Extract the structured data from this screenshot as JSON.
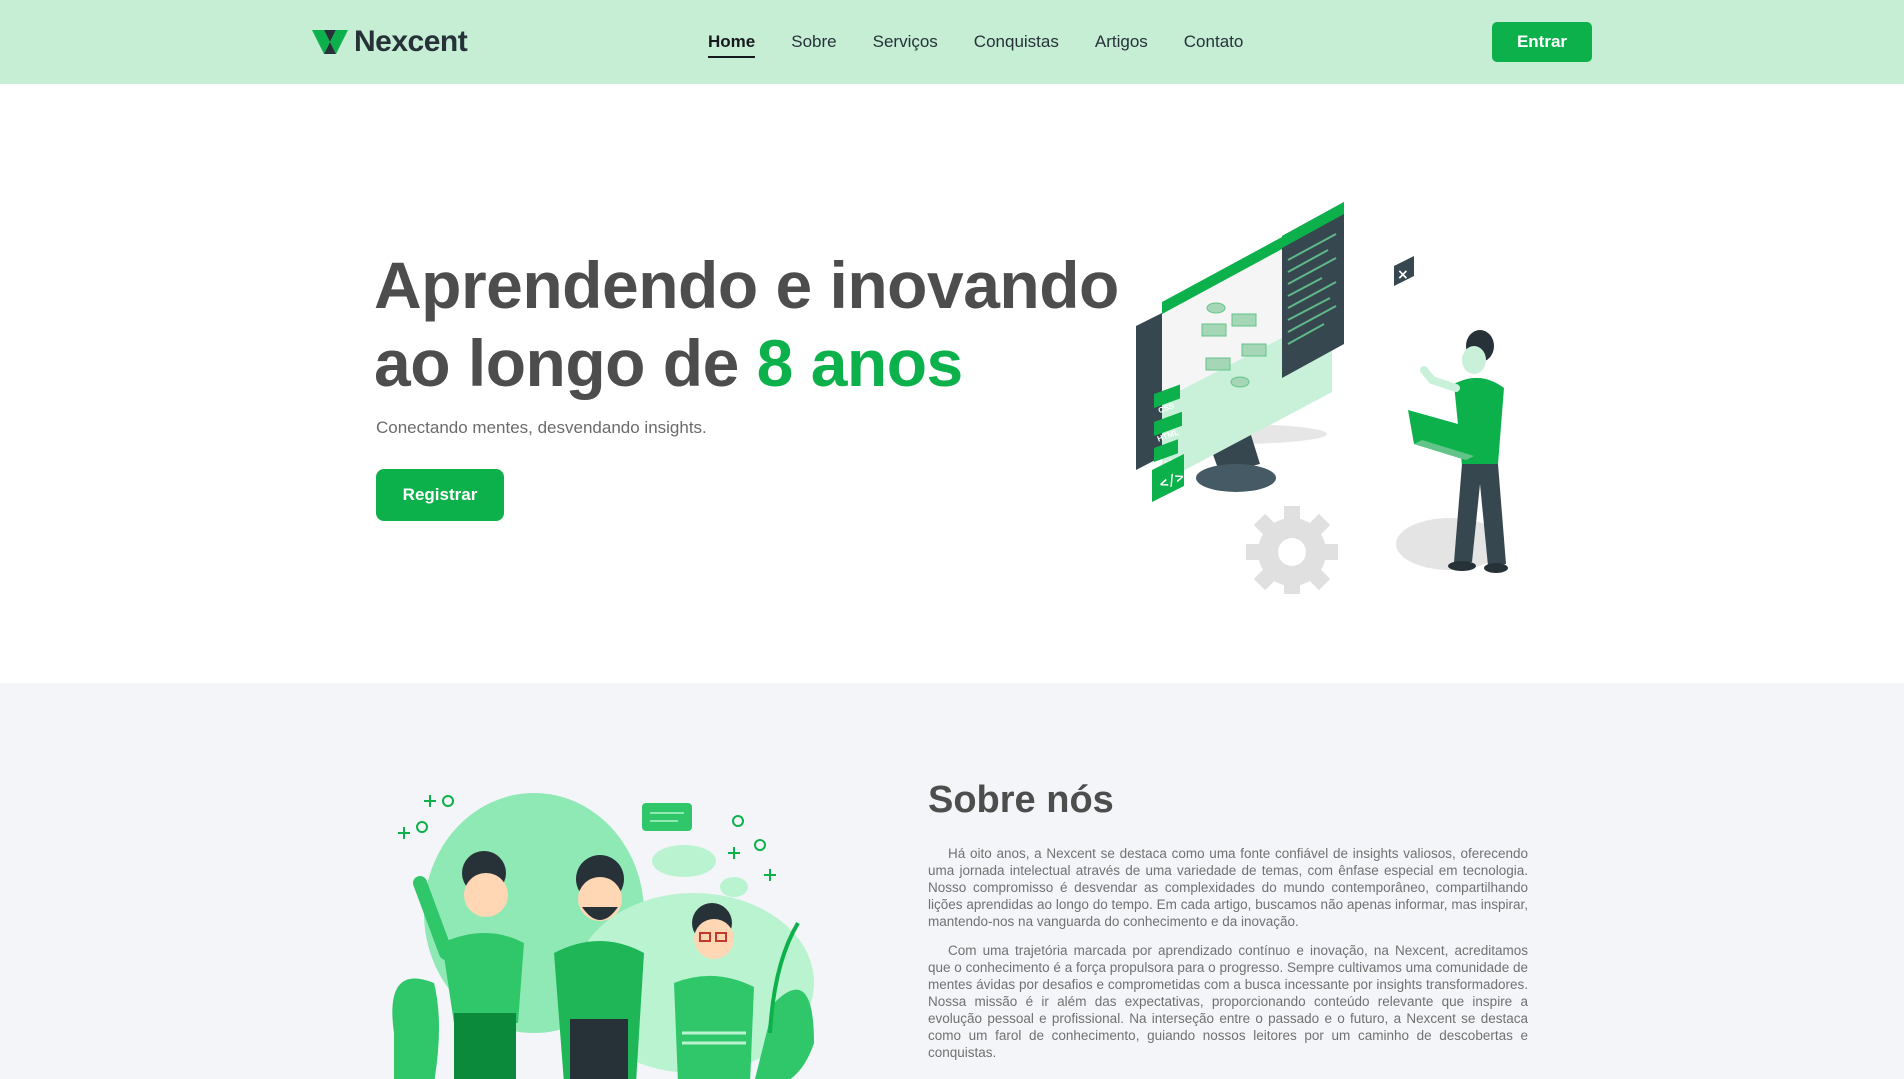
{
  "header": {
    "logo_text": "Nexcent",
    "nav": [
      "Home",
      "Sobre",
      "Serviços",
      "Conquistas",
      "Artigos",
      "Contato"
    ],
    "active_nav": "Home",
    "login_label": "Entrar"
  },
  "hero": {
    "title_line1": "Aprendendo e inovando",
    "title_line2_prefix": "ao longo de ",
    "title_accent": "8 anos",
    "subtitle": "Conectando mentes, desvendando insights.",
    "cta_label": "Registrar",
    "illustration_labels": [
      "CSS",
      "HTML",
      "C++"
    ]
  },
  "about": {
    "title": "Sobre nós",
    "paragraphs": [
      "Há oito anos, a Nexcent se destaca como uma fonte confiável de insights valiosos, oferecendo uma jornada intelectual através de uma variedade de temas, com ênfase especial em tecnologia. Nosso compromisso é desvendar as complexidades do mundo contemporâneo, compartilhando lições aprendidas ao longo do tempo. Em cada artigo, buscamos não apenas informar, mas inspirar, mantendo-nos na vanguarda do conhecimento e da inovação.",
      "Com uma trajetória marcada por aprendizado contínuo e inovação, na Nexcent, acreditamos que o conhecimento é a força propulsora para o progresso. Sempre cultivamos uma comunidade de mentes ávidas por desafios e comprometidas com a busca incessante por insights transformadores. Nossa missão é ir além das expectativas, proporcionando conteúdo relevante que inspire a evolução pessoal e profissional. Na interseção entre o passado e o futuro, a Nexcent se destaca como um farol de conhecimento, guiando nossos leitores por um caminho de descobertas e conquistas."
    ]
  },
  "colors": {
    "brand": "#0db14b",
    "header_bg": "#c5eed5",
    "heading": "#4d4d4d",
    "section_bg": "#f4f5f9"
  }
}
